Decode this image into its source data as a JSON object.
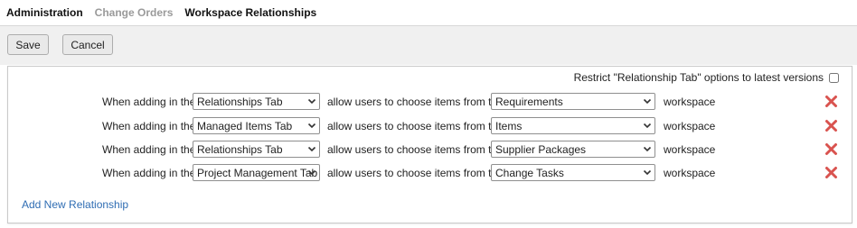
{
  "breadcrumb": [
    "Administration",
    "Change Orders",
    "Workspace Relationships"
  ],
  "toolbar": {
    "save_label": "Save",
    "cancel_label": "Cancel"
  },
  "restrict": {
    "label": "Restrict \"Relationship Tab\" options to latest versions",
    "checked": false
  },
  "row_text": {
    "when": "When adding in the",
    "allow": "allow users to choose items from the",
    "workspace": "workspace"
  },
  "relationships": [
    {
      "tab": "Relationships Tab",
      "workspace": "Requirements"
    },
    {
      "tab": "Managed Items Tab",
      "workspace": "Items"
    },
    {
      "tab": "Relationships Tab",
      "workspace": "Supplier Packages"
    },
    {
      "tab": "Project Management Tab",
      "workspace": "Change Tasks"
    }
  ],
  "add_link": "Add New Relationship",
  "icons": {
    "delete": "delete-x-icon",
    "dropdown": "chevron-down-icon"
  },
  "colors": {
    "delete": "#d9534f",
    "link": "#2f6db3",
    "toolbar_bg": "#f0f0f0"
  }
}
